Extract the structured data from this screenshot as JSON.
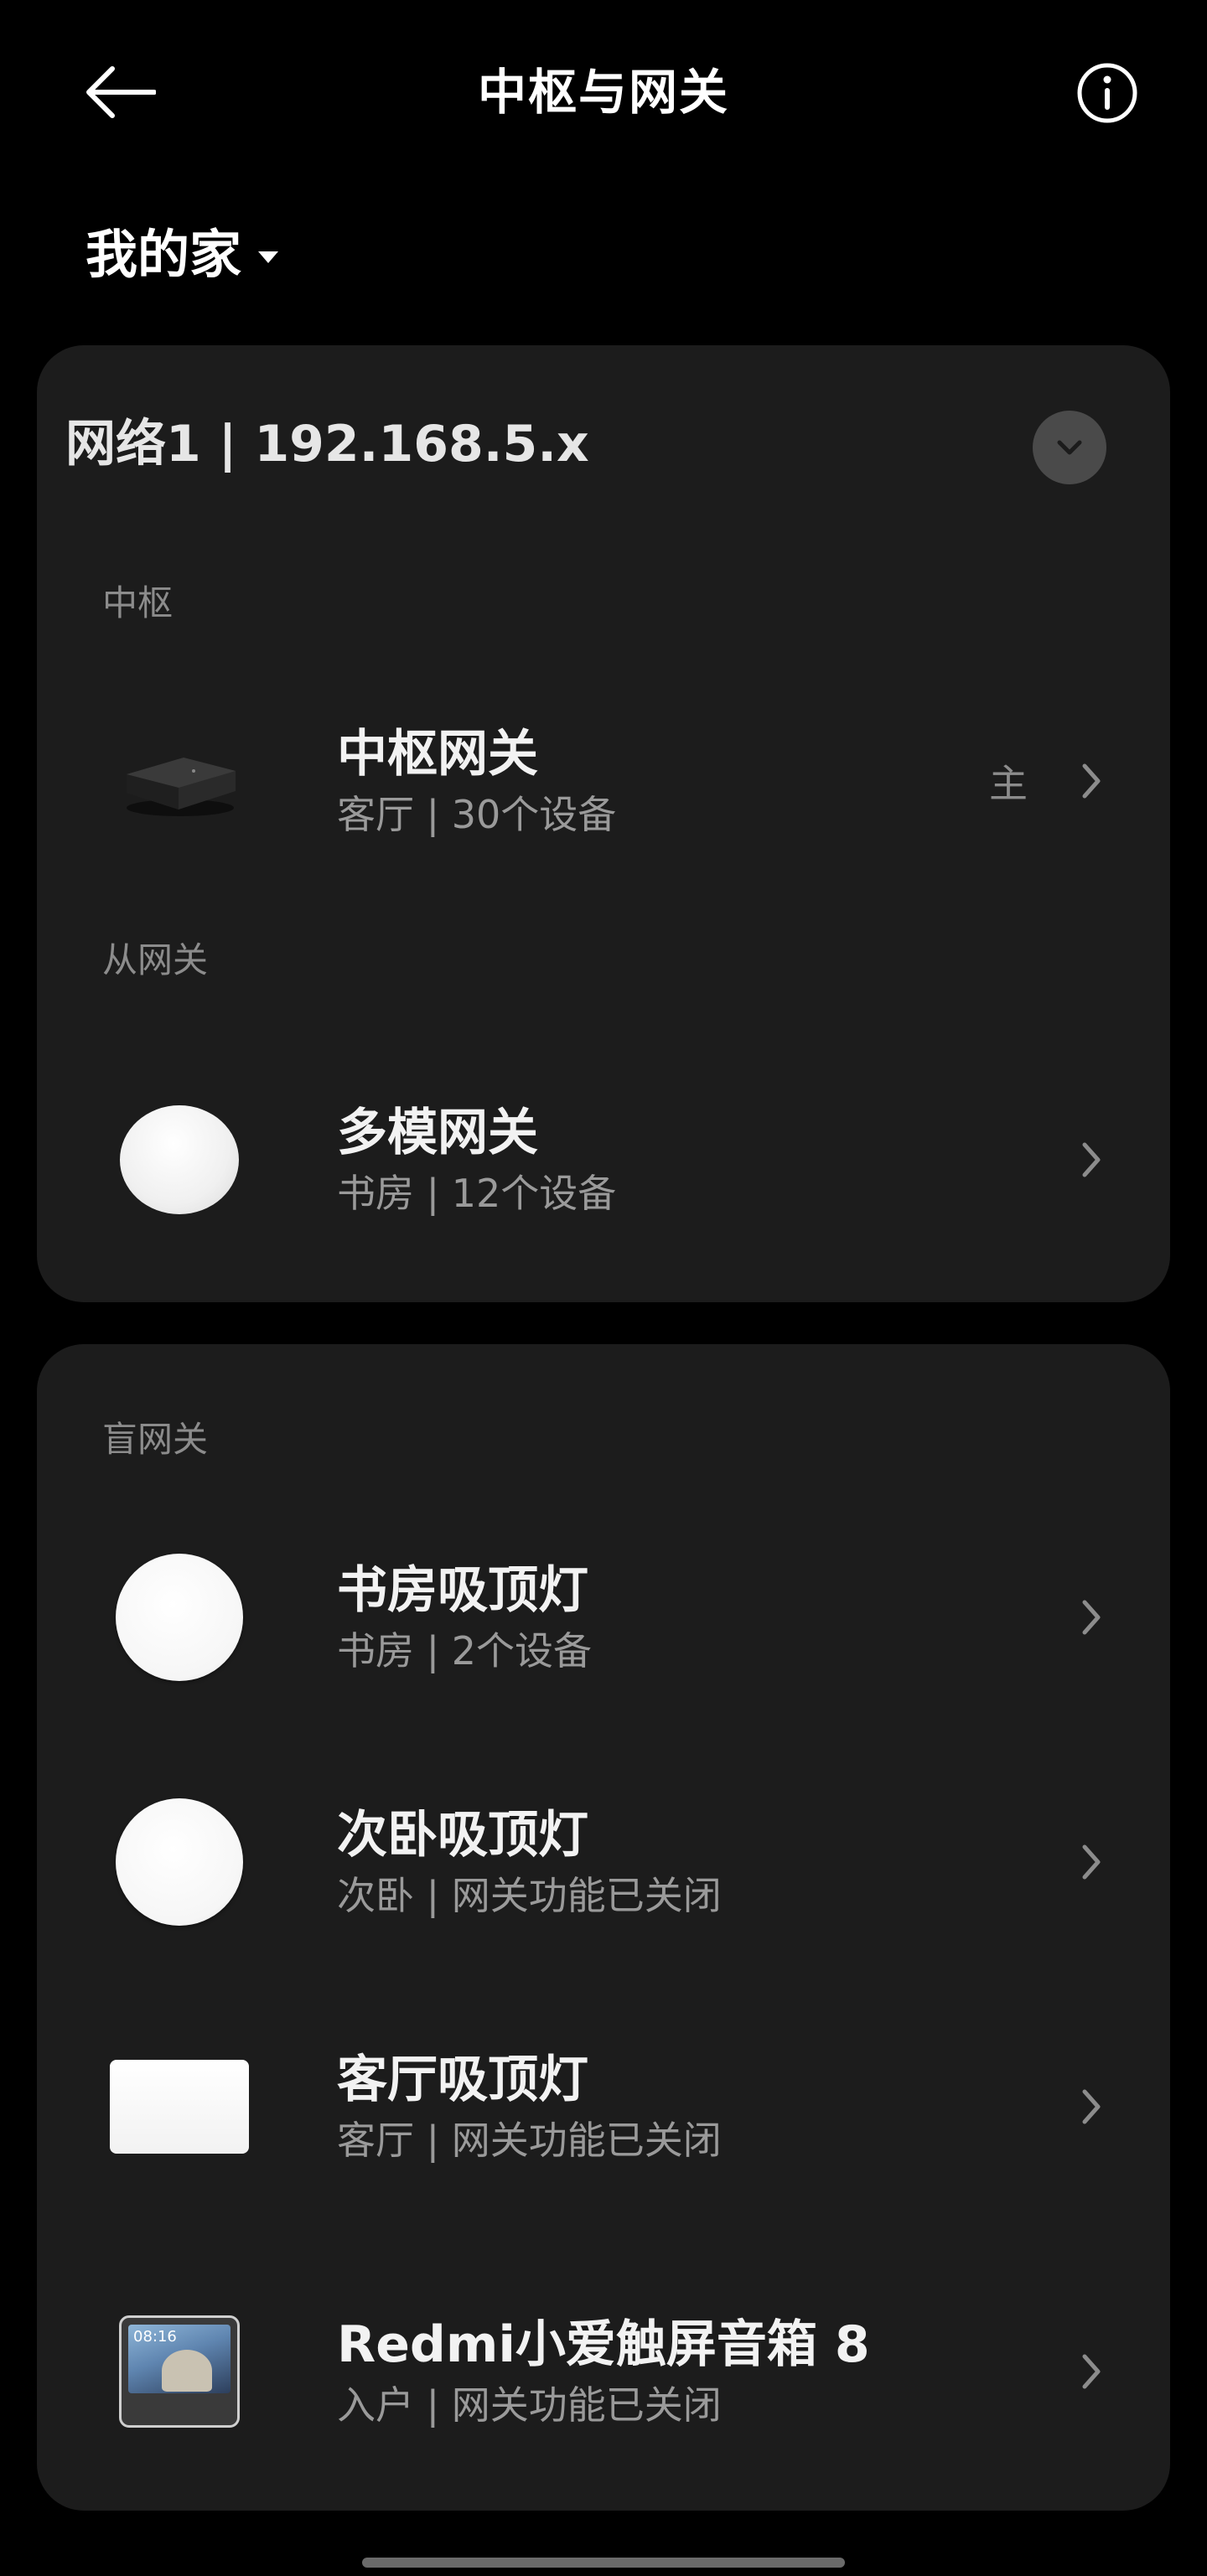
{
  "header": {
    "title": "中枢与网关"
  },
  "home": {
    "name": "我的家"
  },
  "network": {
    "title": "网络1 | 192.168.5.x"
  },
  "sections": {
    "hub_label": "中枢",
    "sub_gateway_label": "从网关",
    "blind_gateway_label": "盲网关"
  },
  "devices": [
    {
      "name": "中枢网关",
      "subtitle": "客厅 | 30个设备",
      "badge": "主",
      "icon": "hub-box-icon"
    },
    {
      "name": "多模网关",
      "subtitle": "书房 | 12个设备",
      "icon": "gateway-puck-icon"
    },
    {
      "name": "书房吸顶灯",
      "subtitle": "书房 | 2个设备",
      "icon": "round-ceiling-light-icon"
    },
    {
      "name": "次卧吸顶灯",
      "subtitle": "次卧 | 网关功能已关闭",
      "icon": "round-ceiling-light-icon"
    },
    {
      "name": "客厅吸顶灯",
      "subtitle": "客厅 | 网关功能已关闭",
      "icon": "rect-ceiling-light-icon"
    },
    {
      "name": "Redmi小爱触屏音箱 8",
      "subtitle": "入户 | 网关功能已关闭",
      "icon": "smart-display-speaker-icon",
      "screen_time": "08:16"
    }
  ],
  "colors": {
    "background": "#000000",
    "card": "#1c1c1c",
    "primary_text": "#f2f2f2",
    "secondary_text": "#9a9a9a",
    "section_label": "#8c8c8c"
  }
}
